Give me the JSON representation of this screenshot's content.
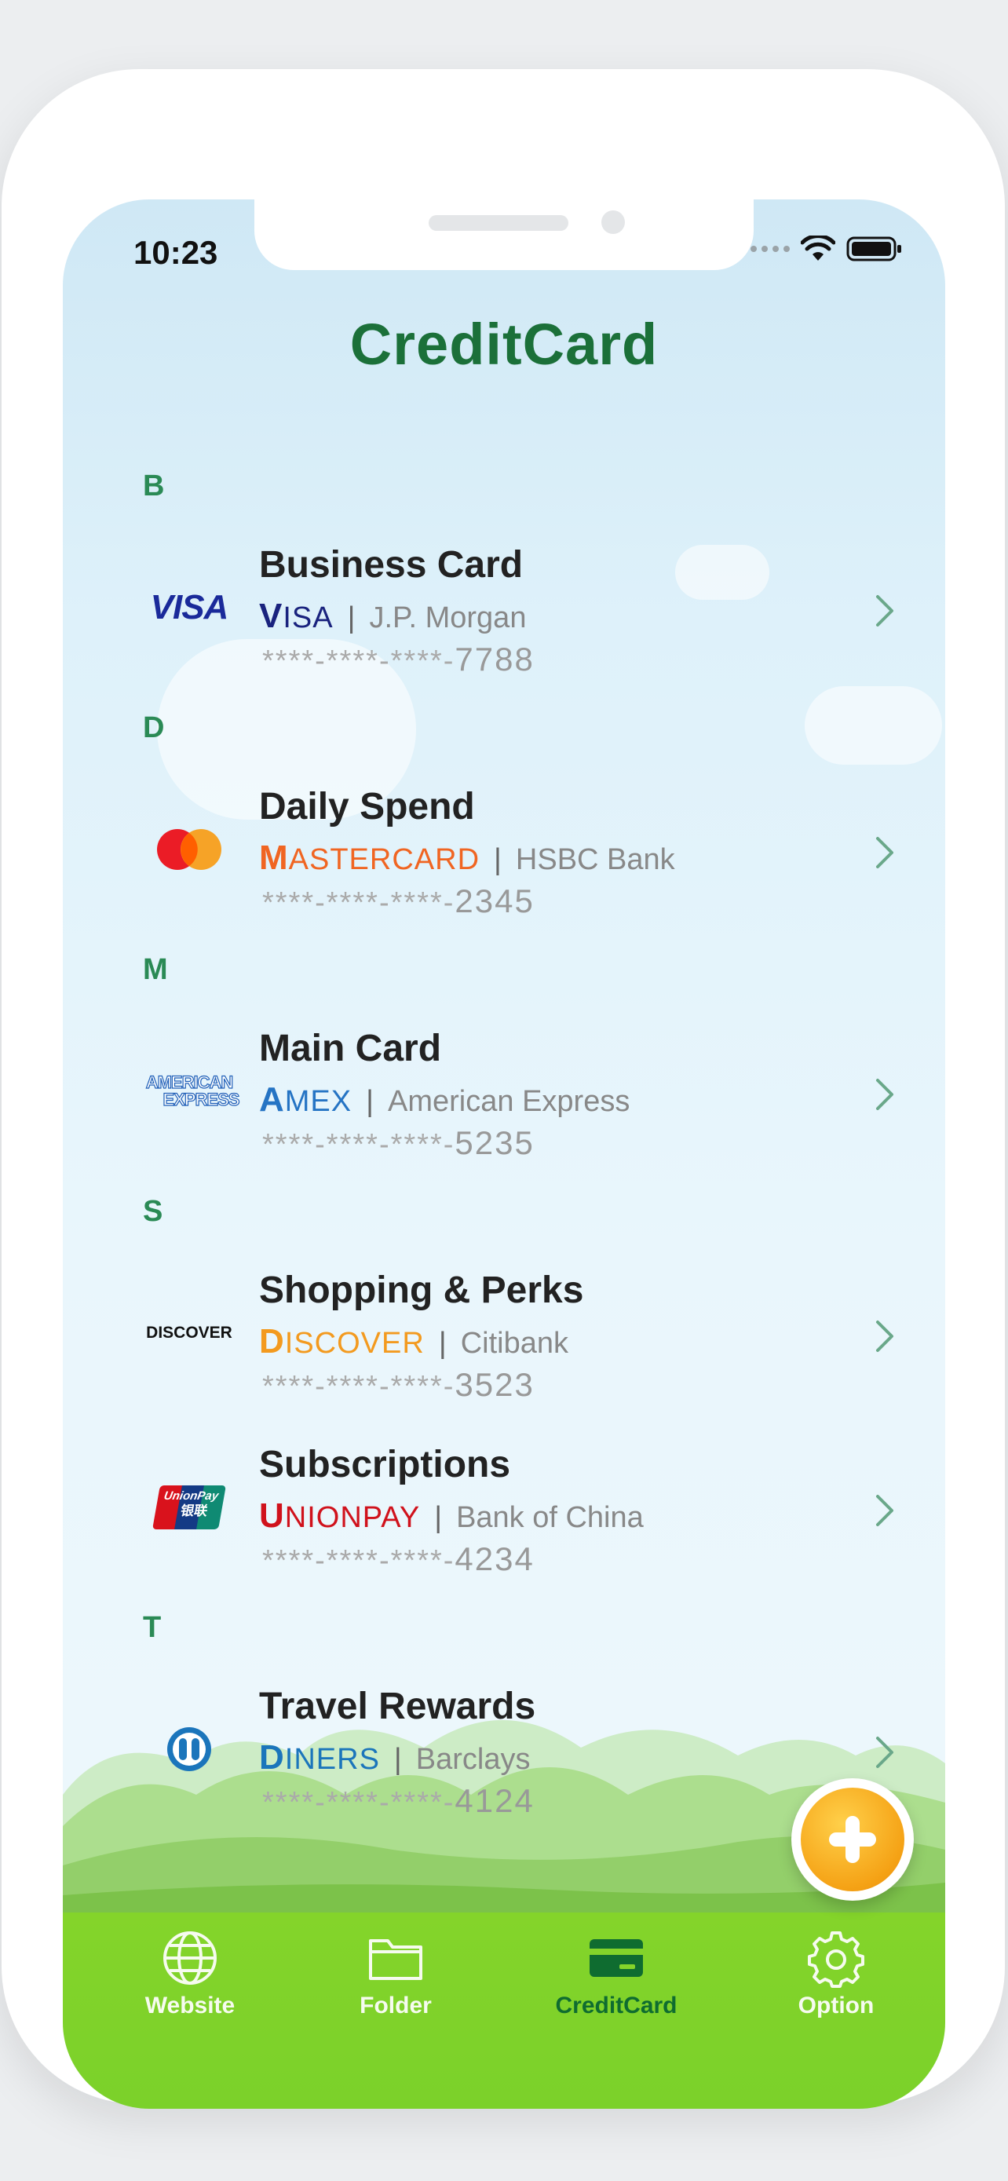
{
  "status_bar": {
    "time": "10:23"
  },
  "title": "CreditCard",
  "sections": [
    {
      "letter": "B"
    },
    {
      "letter": "D"
    },
    {
      "letter": "M"
    },
    {
      "letter": "S"
    },
    {
      "letter": "T"
    }
  ],
  "cards": [
    {
      "name": "Business Card",
      "network_first": "V",
      "network_rest": "ISA",
      "network_color": "#1a237e",
      "bank": "J.P. Morgan",
      "masked": "****-****-****-",
      "last4": "7788",
      "logo": "visa-logo"
    },
    {
      "name": "Daily Spend",
      "network_first": "M",
      "network_rest": "ASTERCARD",
      "network_color": "#f06522",
      "bank": "HSBC Bank",
      "masked": "****-****-****-",
      "last4": "2345",
      "logo": "mastercard-logo"
    },
    {
      "name": "Main Card",
      "network_first": "A",
      "network_rest": "MEX",
      "network_color": "#2574c4",
      "bank": "American Express",
      "masked": "****-****-****-",
      "last4": "5235",
      "logo": "amex-logo"
    },
    {
      "name": "Shopping & Perks",
      "network_first": "D",
      "network_rest": "ISCOVER",
      "network_color": "#f39a1f",
      "bank": "Citibank",
      "masked": "****-****-****-",
      "last4": "3523",
      "logo": "discover-logo"
    },
    {
      "name": "Subscriptions",
      "network_first": "U",
      "network_rest": "NIONPAY",
      "network_color": "#d0121c",
      "bank": "Bank of China",
      "masked": "****-****-****-",
      "last4": "4234",
      "logo": "unionpay-logo"
    },
    {
      "name": "Travel Rewards",
      "network_first": "D",
      "network_rest": "INERS",
      "network_color": "#1b75bb",
      "bank": "Barclays",
      "masked": "****-****-****-",
      "last4": "4124",
      "logo": "diners-logo"
    }
  ],
  "logos": {
    "visa": "VISA",
    "amex_line1": "AMERICAN",
    "amex_line2": "EXPRESS",
    "discover": "DISCOVER",
    "unionpay_line1": "UnionPay",
    "unionpay_line2": "银联"
  },
  "tabs": [
    {
      "label": "Website",
      "icon": "globe-icon"
    },
    {
      "label": "Folder",
      "icon": "folder-icon"
    },
    {
      "label": "CreditCard",
      "icon": "credit-card-icon",
      "active": true
    },
    {
      "label": "Option",
      "icon": "gear-icon"
    }
  ],
  "colors": {
    "title": "#1b7039",
    "section_letter": "#2a8a55",
    "tabbar": "#84d42a",
    "active_tab": "#0f6c30",
    "fab": "#f5a215"
  }
}
